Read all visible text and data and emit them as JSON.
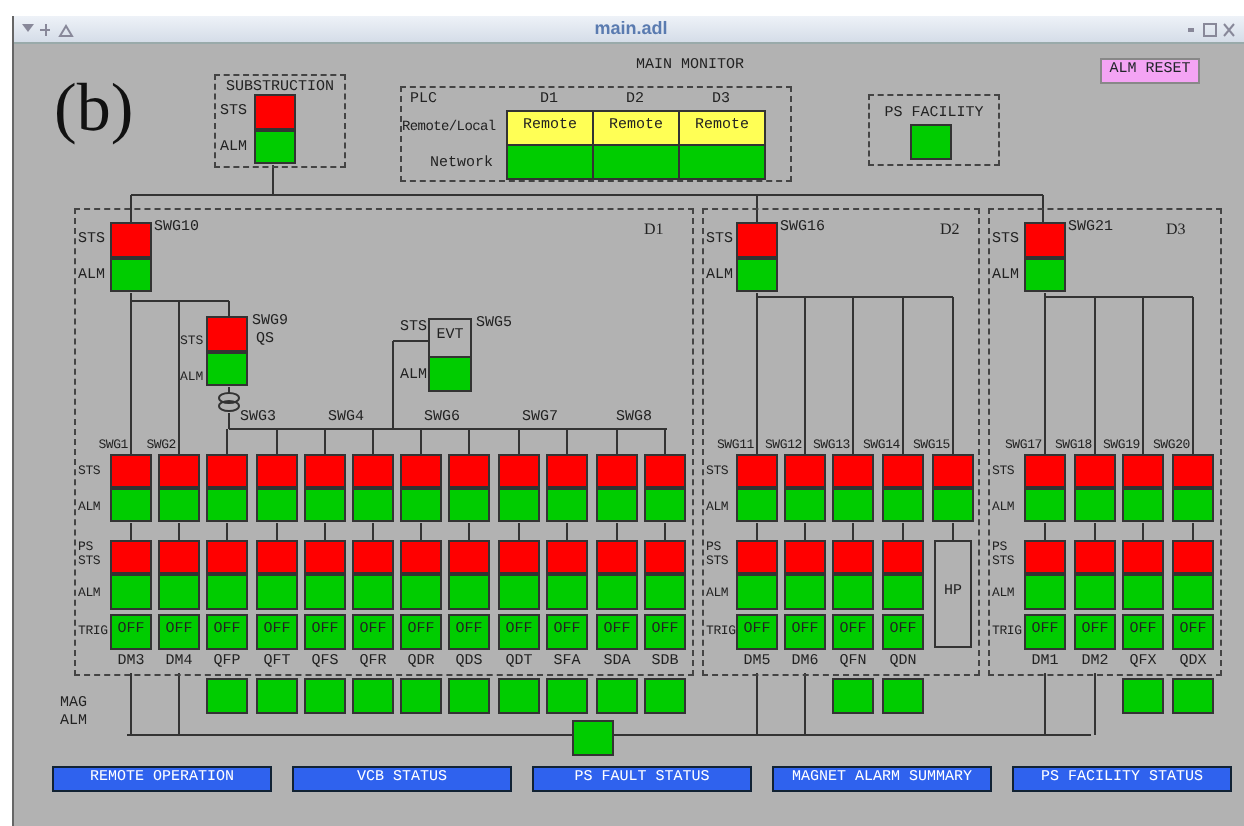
{
  "window": {
    "title": "main.adl"
  },
  "figure_label": "(b)",
  "header": {
    "title": "MAIN MONITOR",
    "reset_button": "ALM RESET"
  },
  "substruction": {
    "title": "SUBSTRUCTION",
    "labels": [
      "STS",
      "ALM"
    ],
    "sts": {
      "color": "#ff0000"
    },
    "alm": {
      "color": "#00cc00"
    }
  },
  "plc": {
    "labels": [
      "PLC",
      "Remote/Local",
      "Network"
    ],
    "columns": [
      {
        "name": "D1",
        "mode": {
          "text": "Remote",
          "color": "#ffff55"
        },
        "network": {
          "color": "#00cc00"
        }
      },
      {
        "name": "D2",
        "mode": {
          "text": "Remote",
          "color": "#ffff55"
        },
        "network": {
          "color": "#00cc00"
        }
      },
      {
        "name": "D3",
        "mode": {
          "text": "Remote",
          "color": "#ffff55"
        },
        "network": {
          "color": "#00cc00"
        }
      }
    ]
  },
  "ps_facility": {
    "title": "PS FACILITY",
    "indicator": {
      "color": "#00cc00"
    }
  },
  "sections": [
    {
      "name": "D1",
      "feeder": {
        "name": "SWG10",
        "labels": [
          "STS",
          "ALM"
        ],
        "sts": {
          "color": "#ff0000"
        },
        "alm": {
          "color": "#00cc00"
        }
      },
      "swg9": {
        "name": "SWG9",
        "sub": "QS",
        "labels": [
          "STS",
          "ALM"
        ],
        "sts": {
          "color": "#ff0000"
        },
        "alm": {
          "color": "#00cc00"
        }
      },
      "evt": {
        "name": "SWG5",
        "text": "EVT",
        "labels": [
          "STS",
          "ALM"
        ],
        "alm": {
          "color": "#00cc00"
        }
      },
      "bus_labels": [
        "SWG3",
        "SWG4",
        "SWG6",
        "SWG7",
        "SWG8"
      ],
      "row_labels": [
        "STS",
        "ALM",
        "PS STS",
        "ALM",
        "TRIG"
      ],
      "columns": [
        {
          "kind": "unit",
          "swg": "SWG1",
          "label": "DM3",
          "sts": {
            "color": "#ff0000"
          },
          "alm": {
            "color": "#00cc00"
          },
          "ps_sts": {
            "color": "#ff0000"
          },
          "ps_alm": {
            "color": "#00cc00"
          },
          "trig": {
            "text": "OFF",
            "color": "#00cc00"
          }
        },
        {
          "kind": "unit",
          "swg": "SWG2",
          "label": "DM4",
          "sts": {
            "color": "#ff0000"
          },
          "alm": {
            "color": "#00cc00"
          },
          "ps_sts": {
            "color": "#ff0000"
          },
          "ps_alm": {
            "color": "#00cc00"
          },
          "trig": {
            "text": "OFF",
            "color": "#00cc00"
          }
        },
        {
          "kind": "unit",
          "label": "QFP",
          "sts": {
            "color": "#ff0000"
          },
          "alm": {
            "color": "#00cc00"
          },
          "ps_sts": {
            "color": "#ff0000"
          },
          "ps_alm": {
            "color": "#00cc00"
          },
          "trig": {
            "text": "OFF",
            "color": "#00cc00"
          },
          "mag": {
            "color": "#00cc00"
          }
        },
        {
          "kind": "unit",
          "label": "QFT",
          "sts": {
            "color": "#ff0000"
          },
          "alm": {
            "color": "#00cc00"
          },
          "ps_sts": {
            "color": "#ff0000"
          },
          "ps_alm": {
            "color": "#00cc00"
          },
          "trig": {
            "text": "OFF",
            "color": "#00cc00"
          },
          "mag": {
            "color": "#00cc00"
          }
        },
        {
          "kind": "unit",
          "label": "QFS",
          "sts": {
            "color": "#ff0000"
          },
          "alm": {
            "color": "#00cc00"
          },
          "ps_sts": {
            "color": "#ff0000"
          },
          "ps_alm": {
            "color": "#00cc00"
          },
          "trig": {
            "text": "OFF",
            "color": "#00cc00"
          },
          "mag": {
            "color": "#00cc00"
          }
        },
        {
          "kind": "unit",
          "label": "QFR",
          "sts": {
            "color": "#ff0000"
          },
          "alm": {
            "color": "#00cc00"
          },
          "ps_sts": {
            "color": "#ff0000"
          },
          "ps_alm": {
            "color": "#00cc00"
          },
          "trig": {
            "text": "OFF",
            "color": "#00cc00"
          },
          "mag": {
            "color": "#00cc00"
          }
        },
        {
          "kind": "unit",
          "label": "QDR",
          "sts": {
            "color": "#ff0000"
          },
          "alm": {
            "color": "#00cc00"
          },
          "ps_sts": {
            "color": "#ff0000"
          },
          "ps_alm": {
            "color": "#00cc00"
          },
          "trig": {
            "text": "OFF",
            "color": "#00cc00"
          },
          "mag": {
            "color": "#00cc00"
          }
        },
        {
          "kind": "unit",
          "label": "QDS",
          "sts": {
            "color": "#ff0000"
          },
          "alm": {
            "color": "#00cc00"
          },
          "ps_sts": {
            "color": "#ff0000"
          },
          "ps_alm": {
            "color": "#00cc00"
          },
          "trig": {
            "text": "OFF",
            "color": "#00cc00"
          },
          "mag": {
            "color": "#00cc00"
          }
        },
        {
          "kind": "unit",
          "label": "QDT",
          "sts": {
            "color": "#ff0000"
          },
          "alm": {
            "color": "#00cc00"
          },
          "ps_sts": {
            "color": "#ff0000"
          },
          "ps_alm": {
            "color": "#00cc00"
          },
          "trig": {
            "text": "OFF",
            "color": "#00cc00"
          },
          "mag": {
            "color": "#00cc00"
          }
        },
        {
          "kind": "unit",
          "label": "SFA",
          "sts": {
            "color": "#ff0000"
          },
          "alm": {
            "color": "#00cc00"
          },
          "ps_sts": {
            "color": "#ff0000"
          },
          "ps_alm": {
            "color": "#00cc00"
          },
          "trig": {
            "text": "OFF",
            "color": "#00cc00"
          },
          "mag": {
            "color": "#00cc00"
          }
        },
        {
          "kind": "unit",
          "label": "SDA",
          "sts": {
            "color": "#ff0000"
          },
          "alm": {
            "color": "#00cc00"
          },
          "ps_sts": {
            "color": "#ff0000"
          },
          "ps_alm": {
            "color": "#00cc00"
          },
          "trig": {
            "text": "OFF",
            "color": "#00cc00"
          },
          "mag": {
            "color": "#00cc00"
          }
        },
        {
          "kind": "unit",
          "label": "SDB",
          "sts": {
            "color": "#ff0000"
          },
          "alm": {
            "color": "#00cc00"
          },
          "ps_sts": {
            "color": "#ff0000"
          },
          "ps_alm": {
            "color": "#00cc00"
          },
          "trig": {
            "text": "OFF",
            "color": "#00cc00"
          },
          "mag": {
            "color": "#00cc00"
          }
        }
      ]
    },
    {
      "name": "D2",
      "feeder": {
        "name": "SWG16",
        "labels": [
          "STS",
          "ALM"
        ],
        "sts": {
          "color": "#ff0000"
        },
        "alm": {
          "color": "#00cc00"
        }
      },
      "row_labels": [
        "STS",
        "ALM",
        "PS STS",
        "ALM",
        "TRIG"
      ],
      "columns": [
        {
          "kind": "unit",
          "swg": "SWG11",
          "label": "DM5",
          "sts": {
            "color": "#ff0000"
          },
          "alm": {
            "color": "#00cc00"
          },
          "ps_sts": {
            "color": "#ff0000"
          },
          "ps_alm": {
            "color": "#00cc00"
          },
          "trig": {
            "text": "OFF",
            "color": "#00cc00"
          }
        },
        {
          "kind": "unit",
          "swg": "SWG12",
          "label": "DM6",
          "sts": {
            "color": "#ff0000"
          },
          "alm": {
            "color": "#00cc00"
          },
          "ps_sts": {
            "color": "#ff0000"
          },
          "ps_alm": {
            "color": "#00cc00"
          },
          "trig": {
            "text": "OFF",
            "color": "#00cc00"
          }
        },
        {
          "kind": "unit",
          "swg": "SWG13",
          "label": "QFN",
          "sts": {
            "color": "#ff0000"
          },
          "alm": {
            "color": "#00cc00"
          },
          "ps_sts": {
            "color": "#ff0000"
          },
          "ps_alm": {
            "color": "#00cc00"
          },
          "trig": {
            "text": "OFF",
            "color": "#00cc00"
          },
          "mag": {
            "color": "#00cc00"
          }
        },
        {
          "kind": "unit",
          "swg": "SWG14",
          "label": "QDN",
          "sts": {
            "color": "#ff0000"
          },
          "alm": {
            "color": "#00cc00"
          },
          "ps_sts": {
            "color": "#ff0000"
          },
          "ps_alm": {
            "color": "#00cc00"
          },
          "trig": {
            "text": "OFF",
            "color": "#00cc00"
          },
          "mag": {
            "color": "#00cc00"
          }
        },
        {
          "kind": "hp",
          "swg": "SWG15",
          "sts": {
            "color": "#ff0000"
          },
          "alm": {
            "color": "#00cc00"
          },
          "hp": "HP"
        }
      ]
    },
    {
      "name": "D3",
      "feeder": {
        "name": "SWG21",
        "labels": [
          "STS",
          "ALM"
        ],
        "sts": {
          "color": "#ff0000"
        },
        "alm": {
          "color": "#00cc00"
        }
      },
      "row_labels": [
        "STS",
        "ALM",
        "PS STS",
        "ALM",
        "TRIG"
      ],
      "columns": [
        {
          "kind": "unit",
          "swg": "SWG17",
          "label": "DM1",
          "sts": {
            "color": "#ff0000"
          },
          "alm": {
            "color": "#00cc00"
          },
          "ps_sts": {
            "color": "#ff0000"
          },
          "ps_alm": {
            "color": "#00cc00"
          },
          "trig": {
            "text": "OFF",
            "color": "#00cc00"
          }
        },
        {
          "kind": "unit",
          "swg": "SWG18",
          "label": "DM2",
          "sts": {
            "color": "#ff0000"
          },
          "alm": {
            "color": "#00cc00"
          },
          "ps_sts": {
            "color": "#ff0000"
          },
          "ps_alm": {
            "color": "#00cc00"
          },
          "trig": {
            "text": "OFF",
            "color": "#00cc00"
          }
        },
        {
          "kind": "unit",
          "swg": "SWG19",
          "label": "QFX",
          "sts": {
            "color": "#ff0000"
          },
          "alm": {
            "color": "#00cc00"
          },
          "ps_sts": {
            "color": "#ff0000"
          },
          "ps_alm": {
            "color": "#00cc00"
          },
          "trig": {
            "text": "OFF",
            "color": "#00cc00"
          },
          "mag": {
            "color": "#00cc00"
          }
        },
        {
          "kind": "unit",
          "swg": "SWG20",
          "label": "QDX",
          "sts": {
            "color": "#ff0000"
          },
          "alm": {
            "color": "#00cc00"
          },
          "ps_sts": {
            "color": "#ff0000"
          },
          "ps_alm": {
            "color": "#00cc00"
          },
          "trig": {
            "text": "OFF",
            "color": "#00cc00"
          },
          "mag": {
            "color": "#00cc00"
          }
        }
      ]
    }
  ],
  "mag_alarm": {
    "label": "MAG ALM",
    "indicator": {
      "color": "#00cc00"
    }
  },
  "buttons": [
    "REMOTE OPERATION",
    "VCB STATUS",
    "PS FAULT STATUS",
    "MAGNET ALARM SUMMARY",
    "PS FACILITY STATUS"
  ]
}
